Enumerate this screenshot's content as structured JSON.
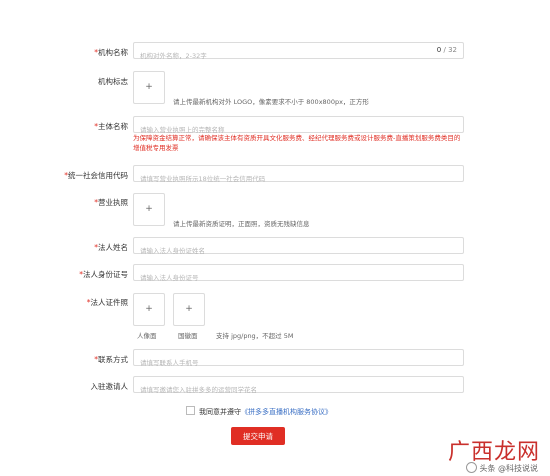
{
  "form": {
    "org_name": {
      "label": "机构名称",
      "placeholder": "机构对外名称，2-32字",
      "count": "0",
      "max": "32"
    },
    "org_logo": {
      "label": "机构标志",
      "hint": "请上传最新机构对外 LOGO，像素要求不小于 800x800px，正方形"
    },
    "entity_name": {
      "label": "主体名称",
      "placeholder": "请输入营业执照上的完整名称",
      "warning": "为保障资金结算正常，请确保该主体有资质开具文化服务费、经纪代理服务费或设计服务费-直播策划服务费类目的增值税专用发票"
    },
    "credit_code": {
      "label": "统一社会信用代码",
      "placeholder": "请填写营业执照所示18位统一社会信用代码"
    },
    "license": {
      "label": "营业执照",
      "hint": "请上传最新资质证明，正面照，资质无残缺信息"
    },
    "legal_name": {
      "label": "法人姓名",
      "placeholder": "请输入法人身份证姓名"
    },
    "legal_id": {
      "label": "法人身份证号",
      "placeholder": "请输入法人身份证号"
    },
    "legal_docs": {
      "label": "法人证件照",
      "front_caption": "人像面",
      "back_caption": "国徽面",
      "hint": "支持 jpg/png，不超过 5M"
    },
    "contact": {
      "label": "联系方式",
      "placeholder": "请填写联系人手机号"
    },
    "inviter": {
      "label": "入驻邀请人",
      "placeholder": "请填写邀请您入驻拼多多的运营同学花名"
    }
  },
  "required_mark": "*",
  "upload_plus": "+",
  "agreement": {
    "prefix": "我同意并遵守",
    "link": "《拼多多直播机构服务协议》"
  },
  "submit_label": "提交申请",
  "watermark": {
    "big": "广西龙网",
    "small": "头条 @科技说说"
  }
}
